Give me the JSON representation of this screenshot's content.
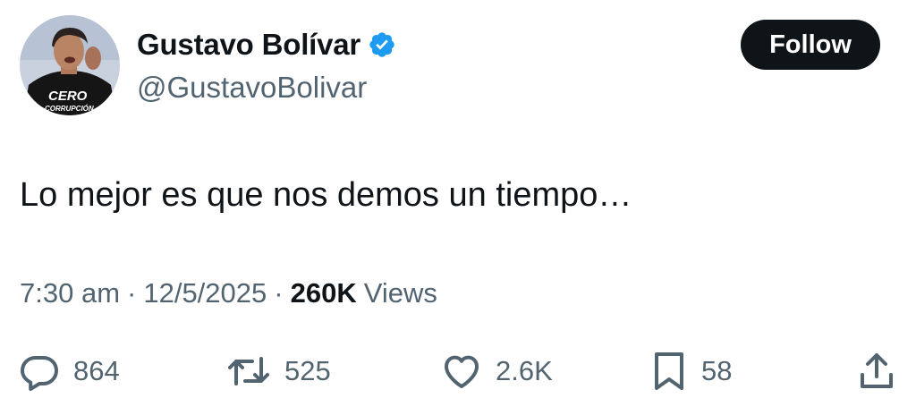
{
  "user": {
    "display_name": "Gustavo Bolívar",
    "handle": "@GustavoBolivar",
    "verified": true,
    "avatar_shirt_text_line1": "CERO",
    "avatar_shirt_text_line2": "CORRUPCIÓN"
  },
  "follow_button": {
    "label": "Follow"
  },
  "tweet": {
    "text": "Lo mejor es que nos demos un tiempo…"
  },
  "meta": {
    "time": "7:30 am",
    "date": "12/5/2025",
    "separator": "·",
    "views_count": "260K",
    "views_label": "Views"
  },
  "actions": {
    "replies": "864",
    "retweets": "525",
    "likes": "2.6K",
    "bookmarks": "58"
  },
  "icons": {
    "verified": "verified-badge-icon",
    "reply": "reply-bubble-icon",
    "retweet": "retweet-arrows-icon",
    "like": "heart-icon",
    "bookmark": "bookmark-icon",
    "share": "share-upload-icon"
  },
  "colors": {
    "verified_blue": "#1d9bf0",
    "primary_text": "#0f1419",
    "secondary_text": "#536471",
    "button_bg": "#0f1419",
    "button_text": "#ffffff"
  }
}
